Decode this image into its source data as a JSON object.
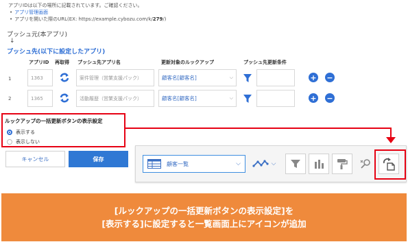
{
  "notes": {
    "line1": "アプリIDは以下の場所に記載されています。ご確認ください。",
    "bullet1": "アプリ管理画面",
    "bullet2_prefix": "アプリを開いた際のURL(EX: https://example.cybozu.com/k/",
    "bullet2_id": "279",
    "bullet2_suffix": "/)"
  },
  "push_source_label": "プッシュ元(本アプリ)",
  "arrow": "↓",
  "push_dest_label": "プッシュ先(以下に設定したアプリ)",
  "table": {
    "headers": [
      "アプリID",
      "再取得",
      "プッシュ先アプリ名",
      "更新対象のルックアップ",
      "プッシュ先更新条件"
    ],
    "rows": [
      {
        "num": "1",
        "app_id": "1363",
        "app_name": "案件管理（営業支援パック）",
        "lookup": "顧客名[顧客名]"
      },
      {
        "num": "2",
        "app_id": "1365",
        "app_name": "活動履歴（営業支援パック）",
        "lookup": "顧客名[顧客名]"
      }
    ]
  },
  "lookup_settings": {
    "title": "ルックアップの一括更新ボタンの表示設定",
    "options": [
      {
        "label": "表示する",
        "selected": true
      },
      {
        "label": "表示しない",
        "selected": false
      }
    ]
  },
  "buttons": {
    "cancel": "キャンセル",
    "save": "保存"
  },
  "toolbar": {
    "view_label": "顧客一覧"
  },
  "banner": {
    "line1": "[ルックアップの一括更新ボタンの表示設定]を",
    "line2": "[表示する]に設定すると一覧画面上にアイコンが追加"
  },
  "colors": {
    "accent": "#2f6fd5",
    "highlight": "#e60012",
    "banner": "#ef8a3c"
  }
}
